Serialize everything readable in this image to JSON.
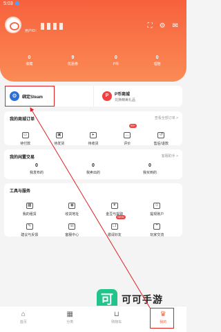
{
  "status_bar": {
    "time": "5:03"
  },
  "profile": {
    "user_tag": "用户ID："
  },
  "stats": [
    {
      "value": "0",
      "label": "收藏"
    },
    {
      "value": "9",
      "label": "优惠券"
    },
    {
      "value": "0",
      "label": "P币"
    },
    {
      "value": "0",
      "label": "理赔"
    }
  ],
  "banner": {
    "steam": {
      "title": "绑定Steam"
    },
    "pshop": {
      "title": "P币商城",
      "subtitle": "兑换精美礼品",
      "icon": "P"
    }
  },
  "orders": {
    "title": "我的商城订单",
    "link": "查看全部订单 >",
    "items": [
      {
        "label": "待付款",
        "icon": "wallet-icon"
      },
      {
        "label": "待发货",
        "icon": "box-icon"
      },
      {
        "label": "待收货",
        "icon": "truck-icon"
      },
      {
        "label": "评价",
        "icon": "comment-icon",
        "badge": "99+"
      },
      {
        "label": "售后/退款",
        "icon": "refund-icon"
      }
    ]
  },
  "idle": {
    "title": "我的闲置交易",
    "link": "客服助手 >",
    "items": [
      {
        "value": "0",
        "label": "我发布的"
      },
      {
        "value": "0",
        "label": "我卖出的"
      },
      {
        "value": "0",
        "label": "我买到的"
      }
    ]
  },
  "tools": {
    "title": "工具与服务",
    "rows": [
      [
        {
          "label": "我的租赁",
          "icon": "calendar-icon"
        },
        {
          "label": "收货地址",
          "icon": "location-icon"
        },
        {
          "label": "金豆与提取",
          "icon": "coin-icon"
        },
        {
          "label": "提现账户",
          "icon": "account-icon"
        }
      ],
      [
        {
          "label": "建议与反馈",
          "icon": "edit-icon"
        },
        {
          "label": "客服中心",
          "icon": "service-icon"
        },
        {
          "label": "邀请好友",
          "icon": "gift-icon",
          "badge": "NEW"
        },
        {
          "label": "玩家交流",
          "icon": "chat-icon"
        }
      ]
    ]
  },
  "bottom_nav": [
    {
      "label": "首页",
      "icon": "home-icon"
    },
    {
      "label": "分类",
      "icon": "grid-icon"
    },
    {
      "label": "购物车",
      "icon": "cart-icon"
    },
    {
      "label": "我的",
      "icon": "user-icon",
      "active": true
    }
  ],
  "watermark": {
    "logo": "可",
    "text": "可可手游"
  },
  "colors": {
    "header": "#f7613d",
    "accent": "#e8683e",
    "highlight": "#e02020",
    "watermark": "#21c48a"
  }
}
